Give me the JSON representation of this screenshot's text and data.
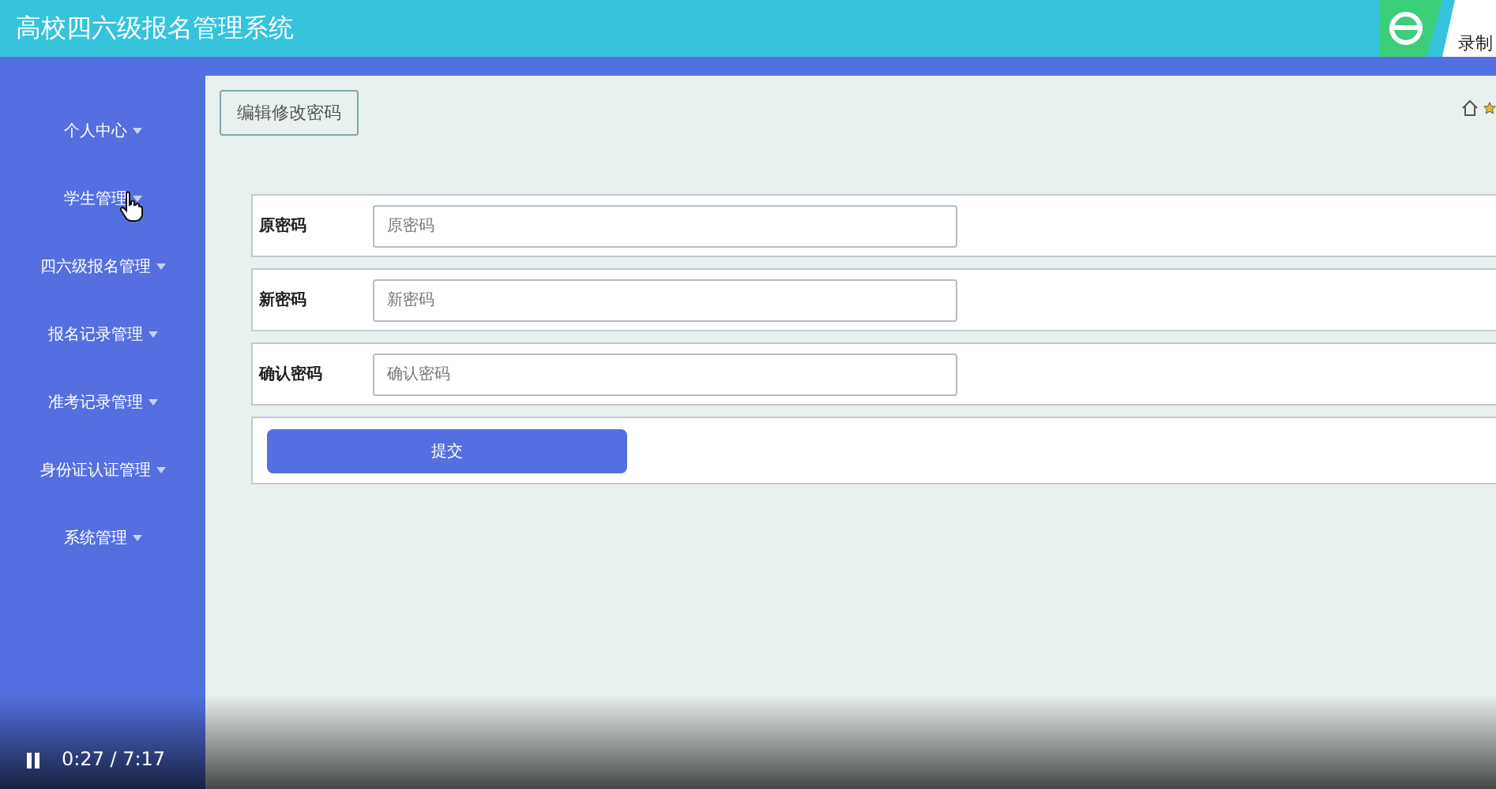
{
  "header": {
    "title": "高校四六级报名管理系统",
    "recorder_badge": {
      "label": "录制"
    }
  },
  "sidebar": {
    "items": [
      {
        "label": "个人中心",
        "hovered": false
      },
      {
        "label": "学生管理",
        "hovered": true
      },
      {
        "label": "四六级报名管理",
        "hovered": false
      },
      {
        "label": "报名记录管理",
        "hovered": false
      },
      {
        "label": "准考记录管理",
        "hovered": false
      },
      {
        "label": "身份证认证管理",
        "hovered": false
      },
      {
        "label": "系统管理",
        "hovered": false
      }
    ]
  },
  "tab": {
    "label": "编辑修改密码"
  },
  "form": {
    "fields": [
      {
        "label": "原密码",
        "placeholder": "原密码"
      },
      {
        "label": "新密码",
        "placeholder": "新密码"
      },
      {
        "label": "确认密码",
        "placeholder": "确认密码"
      }
    ],
    "submit": "提交"
  },
  "player": {
    "playing": true,
    "time": "0:27 / 7:17"
  }
}
